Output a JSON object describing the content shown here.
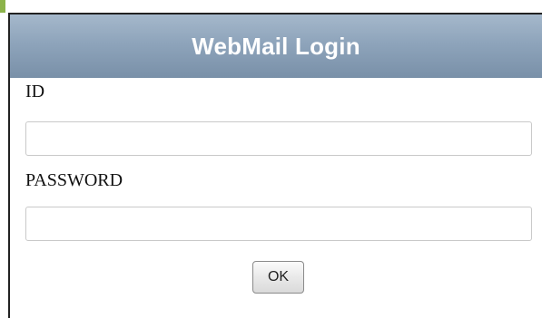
{
  "panel": {
    "title": "WebMail Login"
  },
  "form": {
    "id_label": "ID",
    "id_value": "",
    "password_label": "PASSWORD",
    "password_value": "",
    "ok_label": "OK"
  },
  "colors": {
    "header_top": "#a5b8cb",
    "header_bottom": "#7990a8",
    "header_text": "#ffffff",
    "corner_mark": "#8cb34a"
  }
}
